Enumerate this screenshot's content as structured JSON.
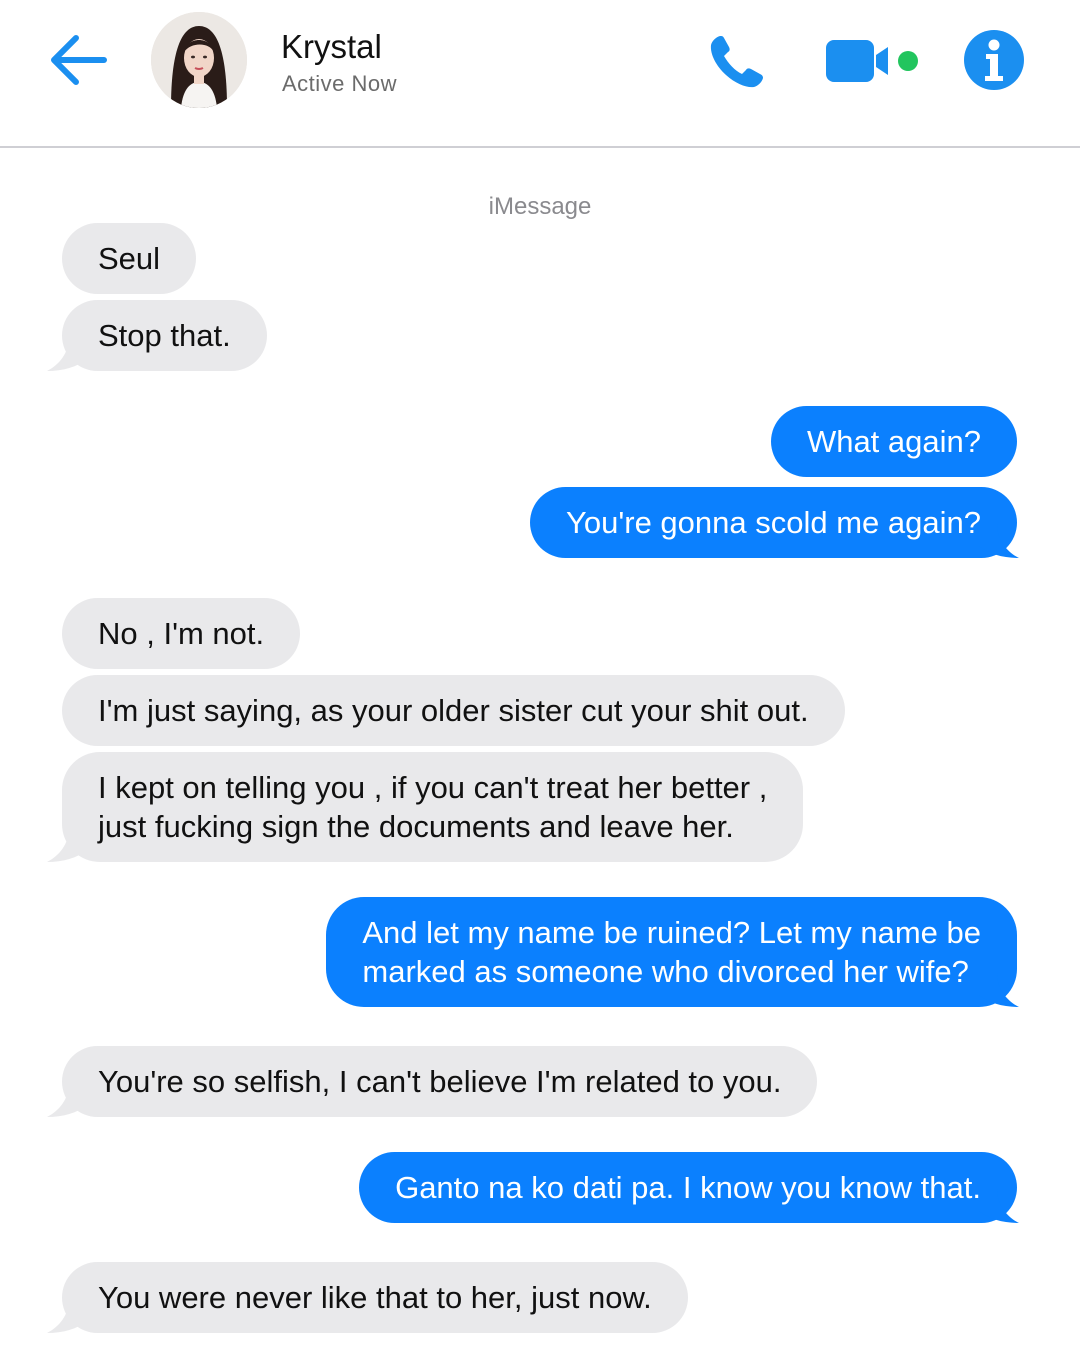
{
  "header": {
    "contact_name": "Krystal",
    "status": "Active Now",
    "avatar_icon": "contact-avatar",
    "back_icon": "back-arrow-icon",
    "call_icon": "phone-icon",
    "video_icon": "video-camera-icon",
    "info_icon": "info-icon",
    "accent_color": "#1b8ff0",
    "online_color": "#22c55e"
  },
  "service_label": "iMessage",
  "messages": [
    {
      "direction": "incoming",
      "lines": [
        "Seul"
      ]
    },
    {
      "direction": "incoming",
      "lines": [
        "Stop that."
      ]
    },
    {
      "direction": "outgoing",
      "lines": [
        "What again?"
      ]
    },
    {
      "direction": "outgoing",
      "lines": [
        "You're gonna scold me again?"
      ]
    },
    {
      "direction": "incoming",
      "lines": [
        "No , I'm not."
      ]
    },
    {
      "direction": "incoming",
      "lines": [
        "I'm just saying, as your older sister cut your shit out."
      ]
    },
    {
      "direction": "incoming",
      "lines": [
        "I kept on telling you , if you can't treat her better ,",
        "just fucking sign the documents and leave her."
      ]
    },
    {
      "direction": "outgoing",
      "lines": [
        "And let my name be ruined? Let my name be",
        "marked as someone who divorced her wife?"
      ]
    },
    {
      "direction": "incoming",
      "lines": [
        "You're so selfish, I can't believe I'm related to you."
      ]
    },
    {
      "direction": "outgoing",
      "lines": [
        "Ganto na ko dati pa. I know you know that."
      ]
    },
    {
      "direction": "incoming",
      "lines": [
        "You were never like that to her, just now."
      ]
    }
  ],
  "colors": {
    "incoming_bubble": "#e9e9eb",
    "outgoing_bubble": "#0b80fe"
  }
}
